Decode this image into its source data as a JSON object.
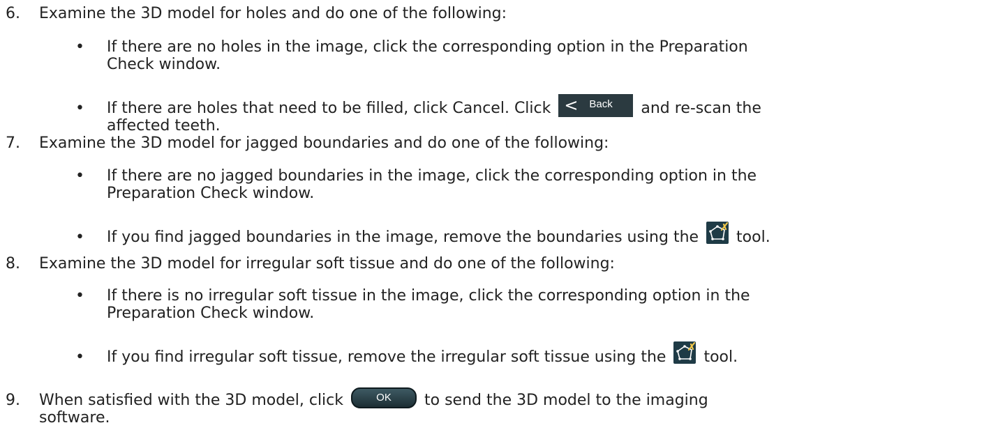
{
  "steps": [
    {
      "number": "6.",
      "text": "Examine the 3D model for holes and do one of the following:",
      "bullets": [
        {
          "line1": "If there are no holes in the image, click the corresponding option in the Preparation",
          "line2": "Check window."
        },
        {
          "before": "If there are holes that need to be filled, click Cancel. Click",
          "after": "and re-scan the",
          "line2": "affected teeth."
        }
      ]
    },
    {
      "number": "7.",
      "text": "Examine the 3D model for jagged boundaries and do one of the following:",
      "bullets": [
        {
          "line1": "If there are no jagged boundaries in the image, click the corresponding option in the",
          "line2": "Preparation Check window."
        },
        {
          "before": "If you find jagged boundaries in the image, remove the boundaries using the",
          "after": "tool."
        }
      ]
    },
    {
      "number": "8.",
      "text": "Examine the 3D model for irregular soft tissue and do one of the following:",
      "bullets": [
        {
          "line1": "If there is no irregular soft tissue in the image, click the corresponding option in the",
          "line2": "Preparation Check window."
        },
        {
          "before": "If you find irregular soft tissue, remove the irregular soft tissue using the",
          "after": "tool."
        }
      ]
    },
    {
      "number": "9.",
      "before": "When satisfied with the 3D model, click",
      "after": "to send the 3D model to the imaging",
      "line2": "software."
    }
  ],
  "bullet_char": "•",
  "back_button": {
    "chevron": "<",
    "label": "Back"
  },
  "ok_button": {
    "label": "OK"
  },
  "icons": {
    "trim_tool": "polygon-scissors-icon"
  },
  "colors": {
    "text": "#222222",
    "button_dark": "#2b3a40",
    "icon_bg": "#1f3b46",
    "scissors": "#f2c84b"
  }
}
